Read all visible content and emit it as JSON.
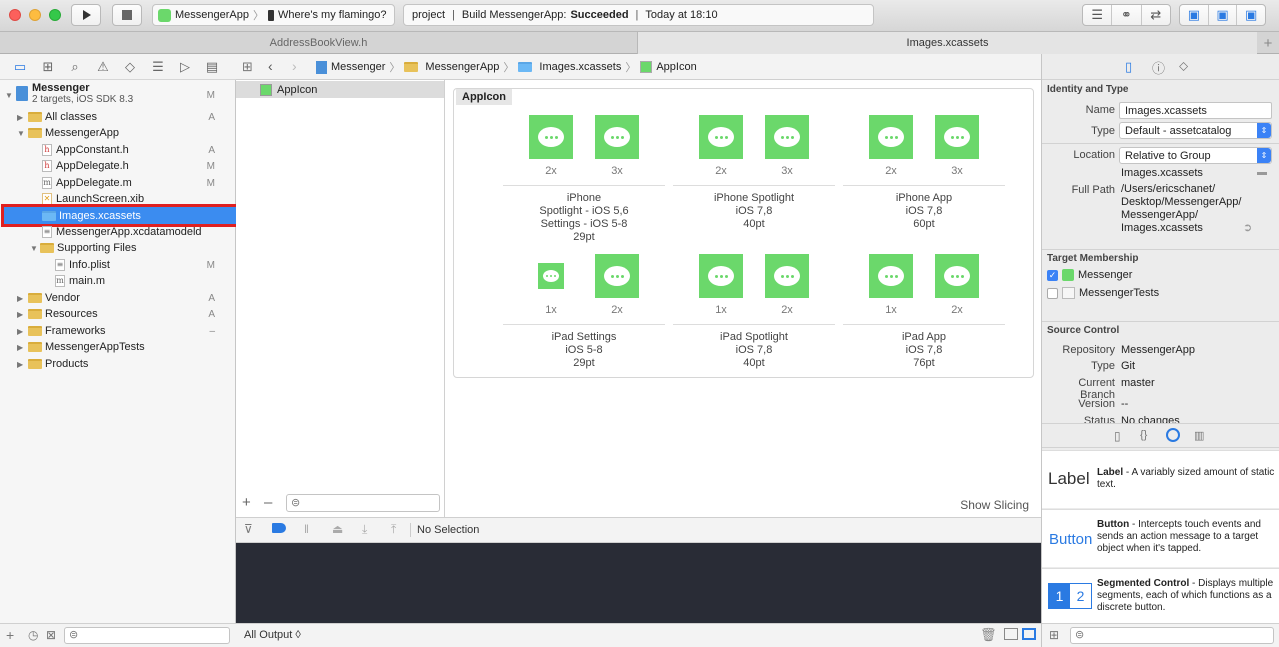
{
  "toolbar": {
    "scheme_name": "MessengerApp",
    "device_name": "Where's my flamingo?",
    "activity_project": "project",
    "activity_prefix": "Build MessengerApp:",
    "activity_status": "Succeeded",
    "activity_time": "Today at 18:10"
  },
  "tabs": [
    {
      "label": "AddressBookView.h"
    },
    {
      "label": "Images.xcassets"
    }
  ],
  "navigator": {
    "project_name": "Messenger",
    "project_subtitle": "2 targets, iOS SDK 8.3",
    "project_badge": "M",
    "items": [
      {
        "label": "All classes",
        "badge": "A"
      },
      {
        "label": "MessengerApp",
        "badge": ""
      },
      {
        "label": "AppConstant.h",
        "badge": "A"
      },
      {
        "label": "AppDelegate.h",
        "badge": "M"
      },
      {
        "label": "AppDelegate.m",
        "badge": "M"
      },
      {
        "label": "LaunchScreen.xib",
        "badge": ""
      },
      {
        "label": "Images.xcassets",
        "badge": ""
      },
      {
        "label": "MessengerApp.xcdatamodeld",
        "badge": ""
      },
      {
        "label": "Supporting Files",
        "badge": ""
      },
      {
        "label": "Info.plist",
        "badge": "M"
      },
      {
        "label": "main.m",
        "badge": ""
      },
      {
        "label": "Vendor",
        "badge": "A"
      },
      {
        "label": "Resources",
        "badge": "A"
      },
      {
        "label": "Frameworks",
        "badge": "–"
      },
      {
        "label": "MessengerAppTests",
        "badge": ""
      },
      {
        "label": "Products",
        "badge": ""
      }
    ]
  },
  "jumpbar": {
    "crumbs": [
      "Messenger",
      "MessengerApp",
      "Images.xcassets",
      "AppIcon"
    ]
  },
  "asset_list": {
    "item": "AppIcon"
  },
  "catalog": {
    "title": "AppIcon",
    "groups": [
      {
        "scales": [
          "2x",
          "3x"
        ],
        "lines": [
          "iPhone",
          "Spotlight - iOS 5,6",
          "Settings - iOS 5-8",
          "29pt"
        ]
      },
      {
        "scales": [
          "2x",
          "3x"
        ],
        "lines": [
          "iPhone Spotlight",
          "iOS 7,8",
          "40pt"
        ]
      },
      {
        "scales": [
          "2x",
          "3x"
        ],
        "lines": [
          "iPhone App",
          "iOS 7,8",
          "60pt"
        ]
      },
      {
        "scales": [
          "1x",
          "2x"
        ],
        "lines": [
          "iPad Settings",
          "iOS 5-8",
          "29pt"
        ]
      },
      {
        "scales": [
          "1x",
          "2x"
        ],
        "lines": [
          "iPad Spotlight",
          "iOS 7,8",
          "40pt"
        ]
      },
      {
        "scales": [
          "1x",
          "2x"
        ],
        "lines": [
          "iPad App",
          "iOS 7,8",
          "76pt"
        ]
      }
    ],
    "show_slicing": "Show Slicing"
  },
  "debug": {
    "no_selection": "No Selection",
    "output_label": "All Output ◊"
  },
  "inspector": {
    "identity_header": "Identity and Type",
    "name_label": "Name",
    "name_value": "Images.xcassets",
    "type_label": "Type",
    "type_value": "Default - assetcatalog",
    "location_label": "Location",
    "location_value": "Relative to Group",
    "location_file": "Images.xcassets",
    "fullpath_label": "Full Path",
    "fullpath_lines": [
      "/Users/ericschanet/",
      "Desktop/MessengerApp/",
      "MessengerApp/",
      "Images.xcassets"
    ],
    "target_header": "Target Membership",
    "targets": [
      {
        "label": "Messenger",
        "checked": true
      },
      {
        "label": "MessengerTests",
        "checked": false
      }
    ],
    "source_header": "Source Control",
    "repository_label": "Repository",
    "repository_value": "MessengerApp",
    "sc_type_label": "Type",
    "sc_type_value": "Git",
    "branch_label": "Current Branch",
    "branch_value": "master",
    "version_label": "Version",
    "version_value": "--",
    "status_label": "Status",
    "status_value": "No changes"
  },
  "library": [
    {
      "preview": "Label",
      "title": "Label",
      "desc": " - A variably sized amount of static text."
    },
    {
      "preview": "Button",
      "title": "Button",
      "desc": " - Intercepts touch events and sends an action message to a target object when it's tapped."
    },
    {
      "preview": "1 2",
      "title": "Segmented Control",
      "desc": " - Displays multiple segments, each of which functions as a discrete button."
    }
  ]
}
